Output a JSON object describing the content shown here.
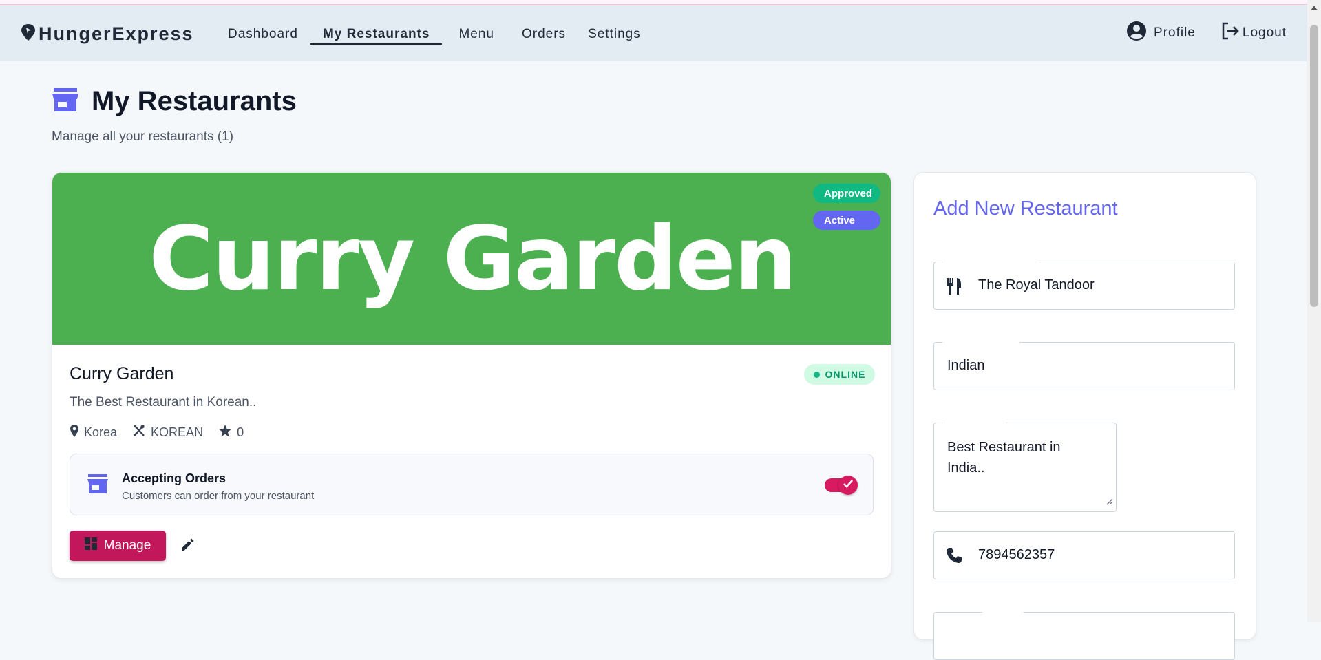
{
  "brand": {
    "name": "HungerExpress",
    "icon": "pin-icon"
  },
  "nav": {
    "links": [
      "Dashboard",
      "My Restaurants",
      "Menu",
      "Orders",
      "Settings"
    ],
    "active_index": 1,
    "profile_label": "Profile",
    "logout_label": "Logout"
  },
  "page": {
    "title": "My Restaurants",
    "subtitle": "Manage all your restaurants (1)"
  },
  "restaurant": {
    "banner_text": "Curry Garden",
    "badge_approved": "Approved",
    "badge_active": "Active",
    "name": "Curry Garden",
    "status": "ONLINE",
    "description": "The Best Restaurant in Korean..",
    "location": "Korea",
    "cuisine": "KOREAN",
    "rating": "0",
    "accepting_title": "Accepting Orders",
    "accepting_sub": "Customers can order from your restaurant",
    "accepting_on": true,
    "manage_label": "Manage"
  },
  "form": {
    "title": "Add New Restaurant",
    "name_value": "The Royal Tandoor",
    "cuisine_value": "Indian",
    "description_value": "Best Restaurant in India..",
    "phone_value": "7894562357"
  },
  "colors": {
    "banner": "#4caf50",
    "accent": "#6366f1",
    "primary_button": "#c2185b",
    "approved": "#10b981"
  }
}
